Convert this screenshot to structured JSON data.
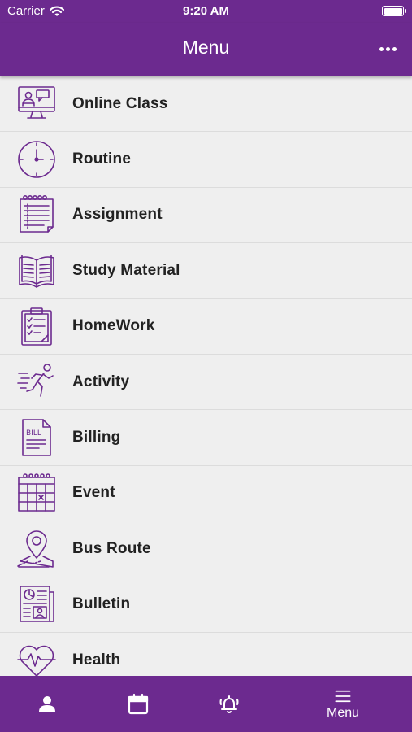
{
  "status_bar": {
    "carrier": "Carrier",
    "time": "9:20 AM",
    "icons": [
      "wifi-icon",
      "battery-icon"
    ]
  },
  "nav_bar": {
    "title": "Menu",
    "more_icon": "more-horizontal-icon"
  },
  "menu_items": [
    {
      "label": "Online Class",
      "icon": "online-class-icon"
    },
    {
      "label": "Routine",
      "icon": "clock-icon"
    },
    {
      "label": "Assignment",
      "icon": "notepad-icon"
    },
    {
      "label": "Study Material",
      "icon": "open-book-icon"
    },
    {
      "label": "HomeWork",
      "icon": "clipboard-icon"
    },
    {
      "label": "Activity",
      "icon": "running-person-icon"
    },
    {
      "label": "Billing",
      "icon": "bill-icon"
    },
    {
      "label": "Event",
      "icon": "calendar-grid-icon"
    },
    {
      "label": "Bus Route",
      "icon": "map-pin-route-icon"
    },
    {
      "label": "Bulletin",
      "icon": "newspaper-icon"
    },
    {
      "label": "Health",
      "icon": "heartbeat-icon"
    }
  ],
  "tab_bar": {
    "tabs": [
      {
        "icon": "person-icon",
        "label": ""
      },
      {
        "icon": "calendar-icon",
        "label": ""
      },
      {
        "icon": "bell-ringing-icon",
        "label": ""
      },
      {
        "icon": "hamburger-menu-icon",
        "label": "Menu"
      }
    ]
  },
  "colors": {
    "brand": "#6c2a8f",
    "icon_stroke": "#6c2a8f",
    "background": "#efefef",
    "text": "#222222"
  }
}
